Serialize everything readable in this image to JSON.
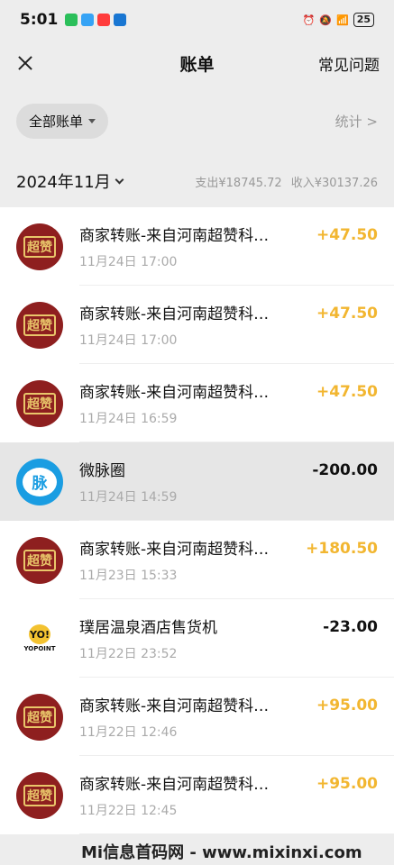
{
  "status": {
    "time": "5:01",
    "battery": "25",
    "app_colors": [
      "#2bbf5a",
      "#36a3f5",
      "#ff3b3b",
      "#1976d2"
    ]
  },
  "nav": {
    "title": "账单",
    "faq": "常见问题"
  },
  "filter": {
    "all_bills": "全部账单",
    "stats": "统计 >"
  },
  "month": {
    "label": "2024年11月",
    "expense": "支出¥18745.72",
    "income": "收入¥30137.26"
  },
  "transactions": [
    {
      "title": "商家转账-来自河南超赞科…",
      "time": "11月24日 17:00",
      "amount": "+47.50",
      "avatar": "brand",
      "avatar_text": "超赞"
    },
    {
      "title": "商家转账-来自河南超赞科…",
      "time": "11月24日 17:00",
      "amount": "+47.50",
      "avatar": "brand",
      "avatar_text": "超赞"
    },
    {
      "title": "商家转账-来自河南超赞科…",
      "time": "11月24日 16:59",
      "amount": "+47.50",
      "avatar": "brand",
      "avatar_text": "超赞"
    },
    {
      "title": "微脉圈",
      "time": "11月24日 14:59",
      "amount": "-200.00",
      "avatar": "mai",
      "avatar_text": "脉"
    },
    {
      "title": "商家转账-来自河南超赞科…",
      "time": "11月23日 15:33",
      "amount": "+180.50",
      "avatar": "brand",
      "avatar_text": "超赞"
    },
    {
      "title": "璞居温泉酒店售货机",
      "time": "11月22日 23:52",
      "amount": "-23.00",
      "avatar": "yo",
      "avatar_text": "YO!",
      "avatar_sub": "YOPOINT"
    },
    {
      "title": "商家转账-来自河南超赞科…",
      "time": "11月22日 12:46",
      "amount": "+95.00",
      "avatar": "brand",
      "avatar_text": "超赞"
    },
    {
      "title": "商家转账-来自河南超赞科…",
      "time": "11月22日 12:45",
      "amount": "+95.00",
      "avatar": "brand",
      "avatar_text": "超赞"
    }
  ],
  "watermark": "Mi信息首码网 - www.mixinxi.com"
}
